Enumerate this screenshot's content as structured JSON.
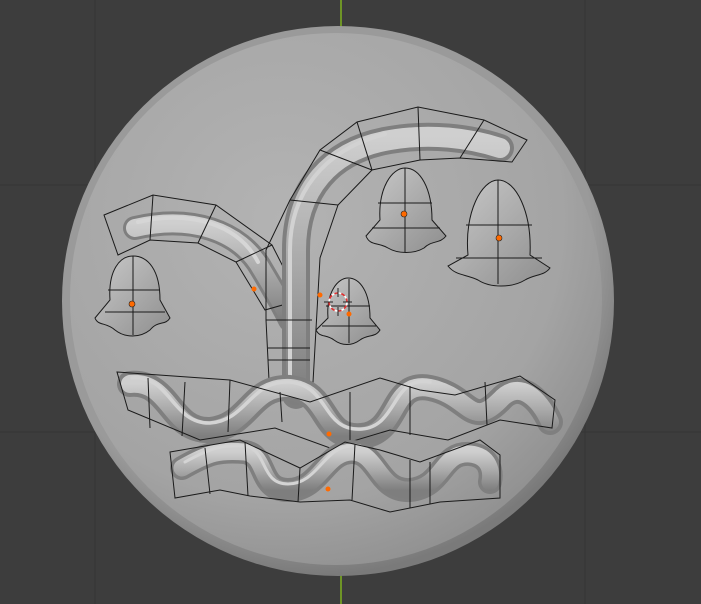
{
  "viewport": {
    "background": "#3d3d3d",
    "grid_color": "#353535",
    "axis_color": "#7fb21f"
  },
  "scene": {
    "object_type": "relief medallion",
    "elements": [
      "disc",
      "branch",
      "bell-flower",
      "wave-stroke",
      "origin-point",
      "3d-cursor"
    ],
    "disc_color": "#a6a6a6",
    "wire_color": "#1a1a1a",
    "origin_color": "#ff6a00"
  }
}
